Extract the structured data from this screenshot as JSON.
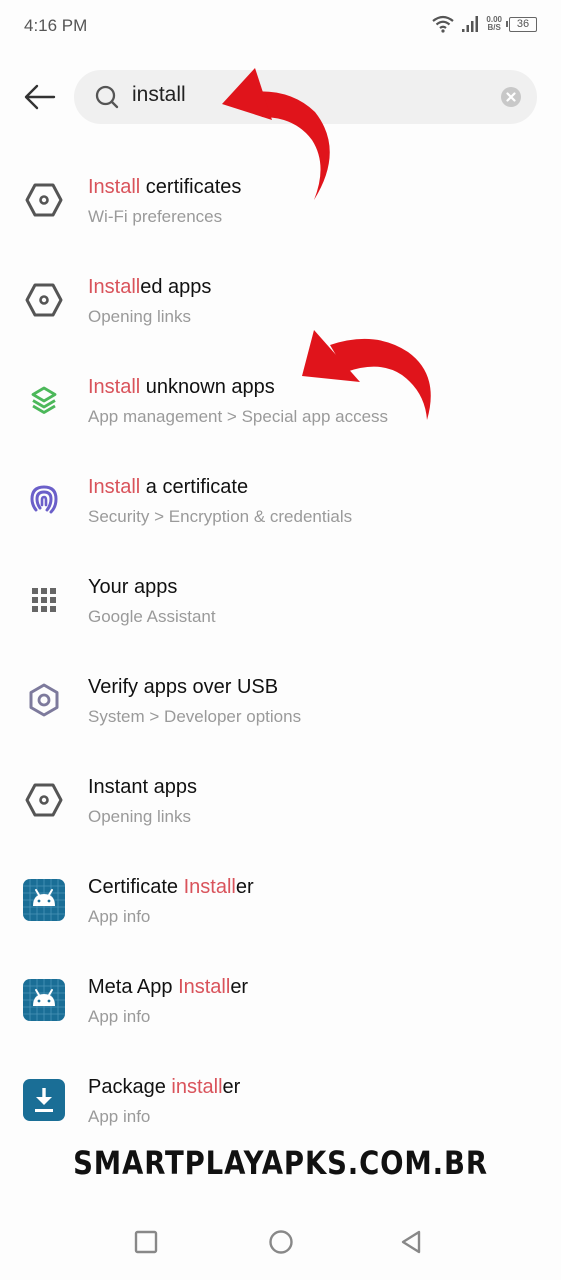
{
  "status_bar": {
    "time": "4:16 PM",
    "net_speed_value": "0.00",
    "net_speed_unit": "B/S",
    "battery_level": "36",
    "icons": [
      "wifi-icon",
      "signal-icon",
      "battery-icon"
    ]
  },
  "search": {
    "query": "install",
    "icons": {
      "back": "arrow-left-icon",
      "search": "search-icon",
      "clear": "clear-icon"
    }
  },
  "colors": {
    "highlight": "#d9535b",
    "annotation_arrow": "#e0141b",
    "app_icon_blue": "#1a6e96",
    "layers_green": "#4cb85a",
    "fingerprint_purple": "#6b5fc9"
  },
  "results": [
    {
      "icon": "hexagon-settings-icon",
      "title_pre": "",
      "title_hl": "Install",
      "title_post": " certificates",
      "subtitle": "Wi-Fi preferences"
    },
    {
      "icon": "hexagon-settings-icon",
      "title_pre": "",
      "title_hl": "Install",
      "title_post": "ed apps",
      "subtitle": "Opening links"
    },
    {
      "icon": "layers-icon",
      "title_pre": "",
      "title_hl": "Install",
      "title_post": " unknown apps",
      "subtitle": "App management > Special app access"
    },
    {
      "icon": "fingerprint-icon",
      "title_pre": "",
      "title_hl": "Install",
      "title_post": " a certificate",
      "subtitle": "Security > Encryption & credentials"
    },
    {
      "icon": "apps-grid-icon",
      "title_pre": "Your apps",
      "title_hl": "",
      "title_post": "",
      "subtitle": "Google Assistant"
    },
    {
      "icon": "hexagon-developer-icon",
      "title_pre": "Verify apps over USB",
      "title_hl": "",
      "title_post": "",
      "subtitle": "System > Developer options"
    },
    {
      "icon": "hexagon-settings-icon",
      "title_pre": "Instant apps",
      "title_hl": "",
      "title_post": "",
      "subtitle": "Opening links"
    },
    {
      "icon": "android-app-icon",
      "title_pre": "Certificate ",
      "title_hl": "Install",
      "title_post": "er",
      "subtitle": "App info"
    },
    {
      "icon": "android-app-icon",
      "title_pre": "Meta App ",
      "title_hl": "Install",
      "title_post": "er",
      "subtitle": "App info"
    },
    {
      "icon": "download-app-icon",
      "title_pre": "Package ",
      "title_hl": "install",
      "title_post": "er",
      "subtitle": "App info"
    }
  ],
  "watermark": "SMARTPLAYAPKS.COM.BR",
  "navbar": {
    "icons": [
      "recents-square-icon",
      "home-circle-icon",
      "back-triangle-icon"
    ]
  }
}
